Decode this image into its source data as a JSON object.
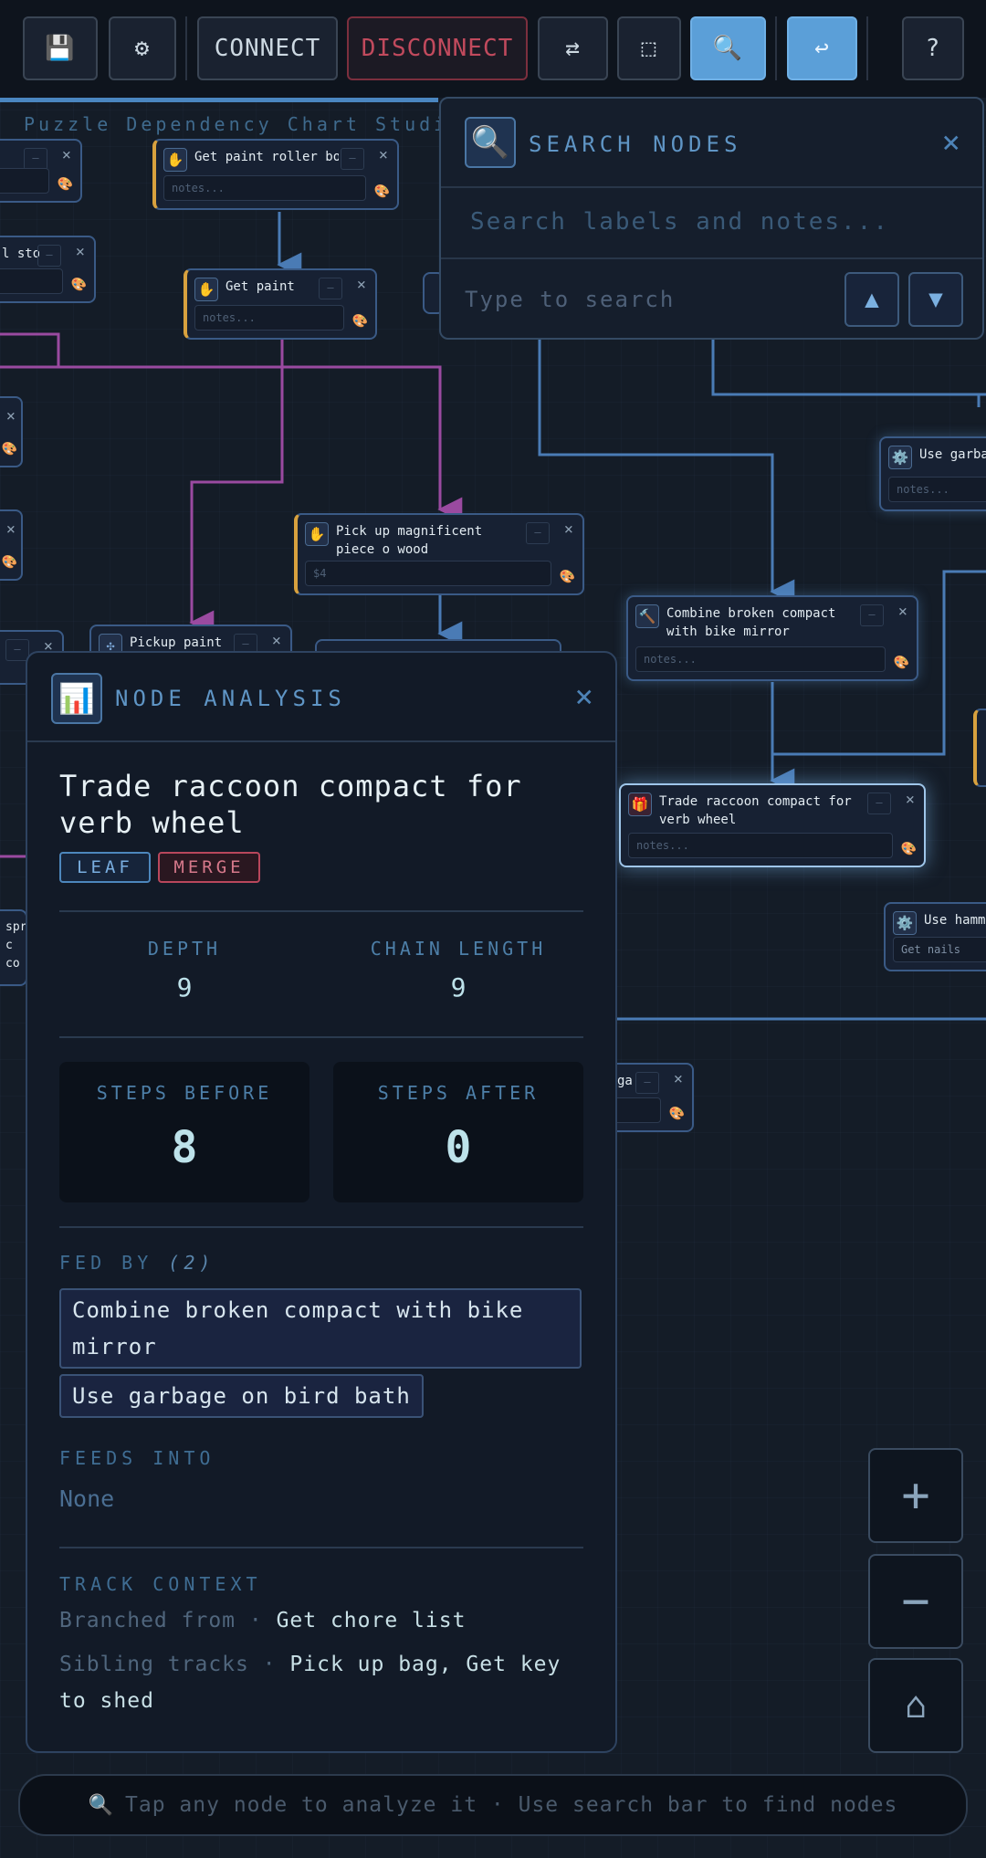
{
  "app": {
    "title": "Puzzle Dependency Chart Studio"
  },
  "toolbar": {
    "save_icon": "💾",
    "settings_icon": "⚙",
    "connect_label": "CONNECT",
    "disconnect_label": "DISCONNECT",
    "swap_icon": "⇄",
    "select_icon": "⬚",
    "search_icon": "🔍",
    "return_icon": "↩",
    "help_label": "?"
  },
  "colors": {
    "accent": "#5b9fd8",
    "danger": "#c14a5d",
    "edge_blue": "#4a7bb5",
    "edge_purple": "#9a4aa0",
    "node_orange": "#d8a13e"
  },
  "search": {
    "icon": "🔍",
    "title": "SEARCH NODES",
    "close_icon": "×",
    "placeholder": "Search labels and notes...",
    "status": "Type to search",
    "prev_icon": "▲",
    "next_icon": "▼"
  },
  "nodes": [
    {
      "id": "n1",
      "label": "",
      "notes": "",
      "icon": "",
      "close": "×"
    },
    {
      "id": "n2",
      "label": "Get paint roller bo",
      "notes": "notes...",
      "icon": "✋",
      "close": "×"
    },
    {
      "id": "n3",
      "label": "l sto",
      "notes": "",
      "icon": "",
      "close": "×"
    },
    {
      "id": "n4",
      "label": "Get paint",
      "notes": "notes...",
      "icon": "✋",
      "close": "×"
    },
    {
      "id": "n5",
      "label": "Use garba",
      "notes": "notes...",
      "icon": "⚙️",
      "close": ""
    },
    {
      "id": "n6",
      "label": "",
      "notes": "",
      "icon": "",
      "close": "×"
    },
    {
      "id": "n7",
      "label": "",
      "notes": "",
      "icon": "",
      "close": "×"
    },
    {
      "id": "n8",
      "label": "Pick up magnificent piece o wood",
      "notes": "$4",
      "icon": "✋",
      "close": "×"
    },
    {
      "id": "n9",
      "label": "Combine broken compact with bike mirror",
      "notes": "notes...",
      "icon": "🔨",
      "close": "×"
    },
    {
      "id": "n10",
      "label": "Pickup paint r",
      "notes": "",
      "icon": "✣",
      "close": "×"
    },
    {
      "id": "n11",
      "label": "",
      "notes": "",
      "icon": "",
      "close": "×"
    },
    {
      "id": "n12",
      "label": "Trade raccoon compact for verb wheel",
      "notes": "notes...",
      "icon": "🎁",
      "close": "×"
    },
    {
      "id": "n13",
      "label": "Use hamm",
      "notes": "Get nails",
      "icon": "⚙️",
      "close": ""
    },
    {
      "id": "n14",
      "label": "spr c co",
      "notes": "",
      "icon": "",
      "close": ""
    },
    {
      "id": "n15",
      "label": "ga",
      "notes": "",
      "icon": "",
      "close": "×"
    }
  ],
  "analysis": {
    "icon": "📊",
    "header_title": "NODE ANALYSIS",
    "close_icon": "×",
    "node_title": "Trade raccoon compact for verb wheel",
    "badges": {
      "leaf": "LEAF",
      "merge": "MERGE"
    },
    "depth_label": "DEPTH",
    "depth_value": "9",
    "chain_label": "CHAIN LENGTH",
    "chain_value": "9",
    "steps_before_label": "STEPS BEFORE",
    "steps_before_value": "8",
    "steps_after_label": "STEPS AFTER",
    "steps_after_value": "0",
    "fed_by_label": "FED BY",
    "fed_by_count": "(2)",
    "fed_by": [
      "Combine broken compact with bike mirror",
      "Use garbage on bird bath"
    ],
    "feeds_into_label": "FEEDS INTO",
    "feeds_into_none": "None",
    "track_context_label": "TRACK CONTEXT",
    "branched_from_label": "Branched from",
    "branched_from_value": "Get chore list",
    "sibling_label": "Sibling tracks",
    "sibling_value": "Pick up bag, Get key to shed",
    "separator": " · "
  },
  "zoom": {
    "in_icon": "+",
    "out_icon": "−",
    "home_icon": "⌂"
  },
  "hint": {
    "icon": "🔍",
    "text": "Tap any node to analyze it · Use search bar to find nodes"
  }
}
